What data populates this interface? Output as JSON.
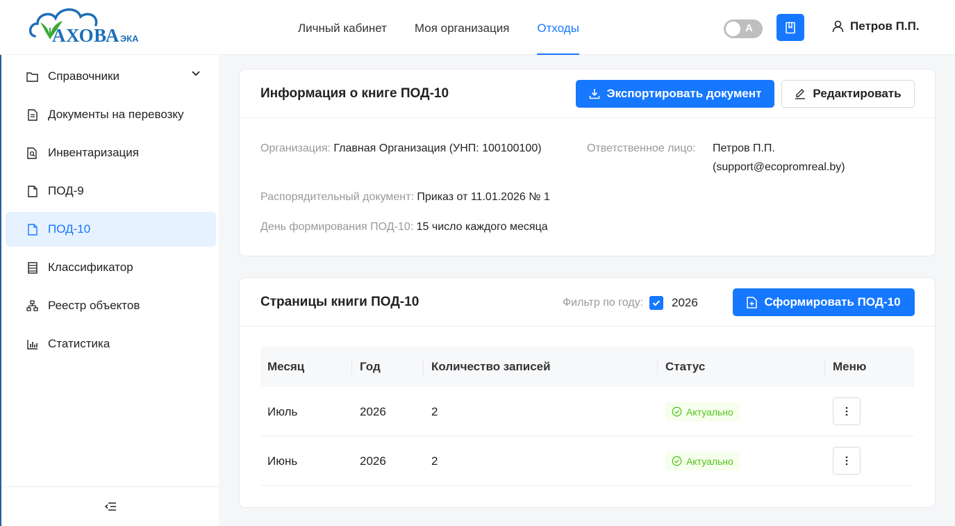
{
  "header": {
    "logo_text": "АХОВА",
    "logo_sub": "ЭКА",
    "nav": [
      {
        "label": "Личный кабинет"
      },
      {
        "label": "Моя организация"
      },
      {
        "label": "Отходы"
      }
    ],
    "active_nav": "Отходы",
    "theme_toggle_letter": "А",
    "user_name": "Петров П.П."
  },
  "sidebar": {
    "items": [
      {
        "label": "Справочники",
        "icon": "folder-icon"
      },
      {
        "label": "Документы на перевозку",
        "icon": "document-icon"
      },
      {
        "label": "Инвентаризация",
        "icon": "document-search-icon"
      },
      {
        "label": "ПОД-9",
        "icon": "file-icon"
      },
      {
        "label": "ПОД-10",
        "icon": "file-icon"
      },
      {
        "label": "Классификатор",
        "icon": "list-book-icon"
      },
      {
        "label": "Реестр объектов",
        "icon": "hierarchy-icon"
      },
      {
        "label": "Статистика",
        "icon": "bar-chart-icon"
      }
    ],
    "active_item": "ПОД-10"
  },
  "info_card": {
    "title": "Информация о книге ПОД-10",
    "export_label": "Экспортировать документ",
    "edit_label": "Редактировать",
    "org_label": "Организация:",
    "org_value": "Главная Организация (УНП: 100100100)",
    "resp_label": "Ответственное лицо:",
    "resp_name": "Петров П.П.",
    "resp_email": "(support@ecopromreal.by)",
    "order_label": "Распорядительный документ:",
    "order_value": "Приказ от 11.01.2026 № 1",
    "day_label": "День формирования ПОД-10:",
    "day_value": "15 число каждого месяца"
  },
  "pages_card": {
    "title": "Страницы книги ПОД-10",
    "filter_label": "Фильтр по году:",
    "filter_year": "2026",
    "filter_checked": true,
    "generate_label": "Сформировать ПОД-10",
    "columns": [
      "Месяц",
      "Год",
      "Количество записей",
      "Статус",
      "Меню"
    ],
    "rows": [
      {
        "month": "Июль",
        "year": "2026",
        "count": "2",
        "status": "Актуально"
      },
      {
        "month": "Июнь",
        "year": "2026",
        "count": "2",
        "status": "Актуально"
      }
    ]
  },
  "colors": {
    "primary": "#1677ff",
    "success": "#52c41a",
    "logo_blue": "#1b6fb8",
    "logo_green": "#3aa935"
  }
}
